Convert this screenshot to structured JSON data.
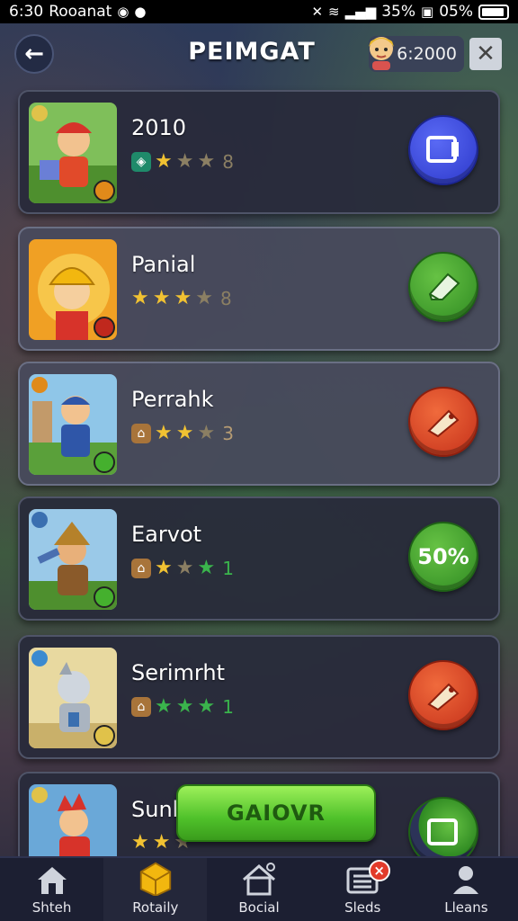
{
  "status": {
    "time": "6:30",
    "left_text": "Rooanat",
    "battery_pct": "35%",
    "right_pct": "05%"
  },
  "header": {
    "title": "PEIMGAT",
    "currency": "6:2000"
  },
  "items": [
    {
      "title": "2010",
      "rating": "8",
      "button": ""
    },
    {
      "title": "Panial",
      "rating": "8",
      "button": ""
    },
    {
      "title": "Perrahk",
      "rating": "3",
      "button": ""
    },
    {
      "title": "Earvot",
      "rating": "1",
      "button": "50%"
    },
    {
      "title": "Serimrht",
      "rating": "1",
      "button": ""
    },
    {
      "title": "Sunb",
      "rating": "",
      "button": ""
    }
  ],
  "cta": {
    "label": "GAIOVR"
  },
  "nav": {
    "items": [
      {
        "label": "Shteh"
      },
      {
        "label": "Rotaily"
      },
      {
        "label": "Bocial"
      },
      {
        "label": "Sleds"
      },
      {
        "label": "Lleans"
      }
    ],
    "badge": "×"
  },
  "colors": {
    "blue_button": "#3a48e0",
    "green_button": "#44a82c",
    "red_button": "#e0462a",
    "cta": "#5ed330"
  }
}
